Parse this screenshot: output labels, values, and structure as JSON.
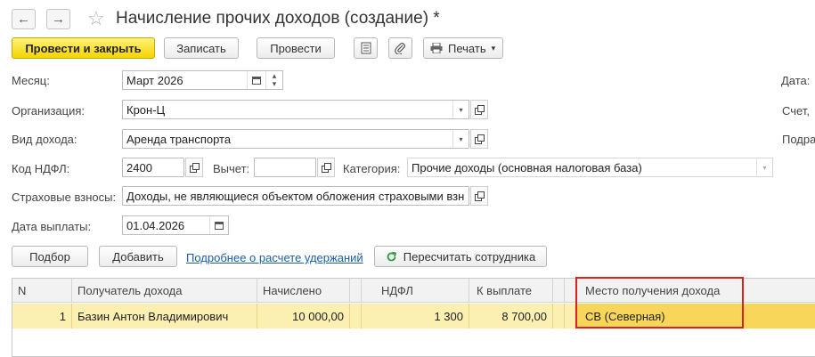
{
  "window": {
    "title": "Начисление прочих доходов (создание) *"
  },
  "nav": {
    "back_icon": "←",
    "forward_icon": "→",
    "star_icon": "☆"
  },
  "toolbar": {
    "post_and_close": "Провести и закрыть",
    "save": "Записать",
    "post": "Провести",
    "print": "Печать",
    "dropdown_arrow": "▾"
  },
  "form": {
    "month": {
      "label": "Месяц:",
      "value": "Март 2026"
    },
    "organization": {
      "label": "Организация:",
      "value": "Крон-Ц"
    },
    "income_type": {
      "label": "Вид дохода:",
      "value": "Аренда транспорта"
    },
    "ndfl_code": {
      "label": "Код НДФЛ:",
      "value": "2400"
    },
    "deduction": {
      "label": "Вычет:",
      "value": ""
    },
    "category": {
      "label": "Категория:",
      "value": "Прочие доходы (основная налоговая база)"
    },
    "insurance": {
      "label": "Страховые взносы:",
      "value": "Доходы, не являющиеся объектом обложения страховыми взн"
    },
    "payment_date": {
      "label": "Дата выплаты:",
      "value": "01.04.2026"
    },
    "right_labels": {
      "date": "Дата:",
      "account": "Счет,",
      "division": "Подра"
    }
  },
  "table_toolbar": {
    "select": "Подбор",
    "add": "Добавить",
    "details_link": "Подробнее о расчете удержаний",
    "recalc": "Пересчитать сотрудника"
  },
  "table": {
    "columns": [
      "N",
      "Получатель дохода",
      "Начислено",
      "НДФЛ",
      "К выплате",
      "Место получения дохода"
    ],
    "rows": [
      {
        "n": "1",
        "recipient": "Базин Антон Владимирович",
        "accrued": "10 000,00",
        "ndfl": "1 300",
        "payout": "8 700,00",
        "place": "СВ (Северная)"
      }
    ]
  },
  "colors": {
    "accent_yellow": "#f5d400",
    "row_highlight": "#fbefb2",
    "selection_red": "#e0201b",
    "link_blue": "#1a5ea8"
  }
}
